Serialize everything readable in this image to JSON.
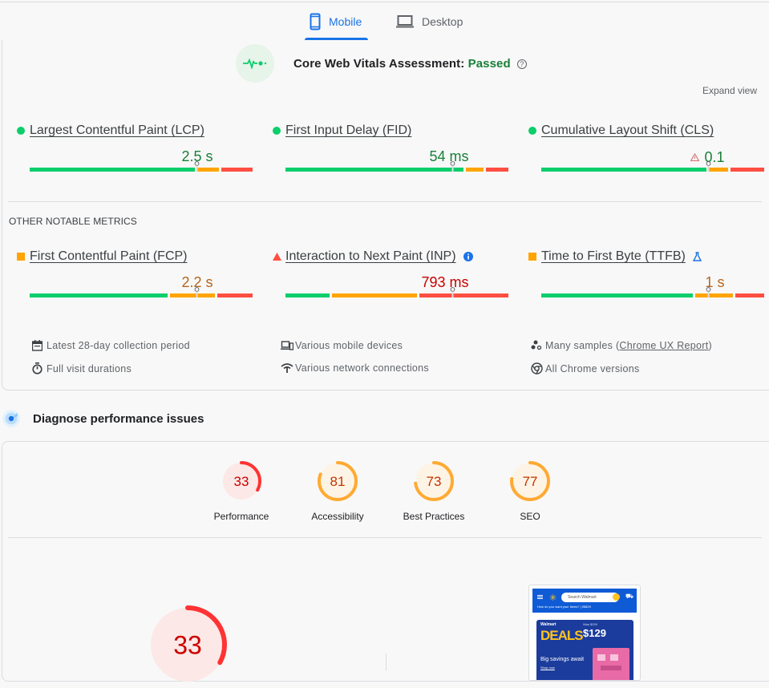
{
  "tabs": [
    {
      "label": "Mobile",
      "icon": "smartphone-icon",
      "active": true
    },
    {
      "label": "Desktop",
      "icon": "laptop-icon",
      "active": false
    }
  ],
  "assessment": {
    "prefix": "Core Web Vitals Assessment: ",
    "status": "Passed",
    "status_color": "#188038",
    "help_icon": "help-icon",
    "expand_label": "Expand view"
  },
  "core_metrics": [
    {
      "name": "Largest Contentful Paint (LCP)",
      "value": "2.5 s",
      "rating": "good",
      "marker": "circle",
      "distribution": [
        0.75,
        0.11,
        0.14
      ],
      "percentile_position": 0.75
    },
    {
      "name": "First Input Delay (FID)",
      "value": "54 ms",
      "rating": "good",
      "marker": "circle",
      "distribution": [
        0.81,
        0.09,
        0.1
      ],
      "percentile_position": 0.75
    },
    {
      "name": "Cumulative Layout Shift (CLS)",
      "value": "0.1",
      "rating": "good",
      "marker": "circle",
      "value_icon": "warning-triangle-icon",
      "distribution": [
        0.75,
        0.1,
        0.15
      ],
      "percentile_position": 0.75
    }
  ],
  "other_label": "OTHER NOTABLE METRICS",
  "other_metrics": [
    {
      "name": "First Contentful Paint (FCP)",
      "value": "2.2 s",
      "rating": "needs-improvement",
      "marker": "square",
      "distribution": [
        0.63,
        0.21,
        0.16
      ],
      "percentile_position": 0.75
    },
    {
      "name": "Interaction to Next Paint (INP)",
      "value": "793 ms",
      "rating": "poor",
      "marker": "triangle",
      "extra_icon": "info-icon",
      "distribution": [
        0.21,
        0.39,
        0.4
      ],
      "percentile_position": 0.75
    },
    {
      "name": "Time to First Byte (TTFB)",
      "value": "1 s",
      "rating": "needs-improvement",
      "marker": "square",
      "extra_icon": "experimental-flask-icon",
      "distribution": [
        0.69,
        0.18,
        0.13
      ],
      "percentile_position": 0.75
    }
  ],
  "colors": {
    "good": "#0cce6b",
    "needs_improvement": "#ffa400",
    "poor": "#ff4e42",
    "good_text": "#188038",
    "ni_text": "#b3661e",
    "poor_text": "#c80000",
    "accent": "#1a73e8"
  },
  "info_items": [
    {
      "icon": "calendar-icon",
      "text": "Latest 28-day collection period"
    },
    {
      "icon": "stopwatch-icon",
      "text": "Full visit durations"
    },
    {
      "icon": "devices-icon",
      "text": "Various mobile devices"
    },
    {
      "icon": "network-icon",
      "text": "Various network connections"
    },
    {
      "icon": "samples-icon",
      "text_before": "Many samples (",
      "link": "Chrome UX Report",
      "text_after": ")"
    },
    {
      "icon": "chrome-icon",
      "text": "All Chrome versions"
    }
  ],
  "diagnose": {
    "title": "Diagnose performance issues",
    "icon": "lighthouse-radar-icon"
  },
  "scores": [
    {
      "label": "Performance",
      "score": 33,
      "rating": "poor"
    },
    {
      "label": "Accessibility",
      "score": 81,
      "rating": "average"
    },
    {
      "label": "Best Practices",
      "score": 73,
      "rating": "average"
    },
    {
      "label": "SEO",
      "score": 77,
      "rating": "average"
    }
  ],
  "big_score": {
    "score": 33,
    "rating": "poor"
  },
  "screenshot": {
    "search_placeholder": "Search Walmart",
    "banner_text": "How do you want your items? | 95829",
    "brand": "Walmart",
    "deals": "DEALS",
    "was_price": "Was $299",
    "price": "$129",
    "tagline": "Big savings await",
    "cta": "Shop now"
  }
}
